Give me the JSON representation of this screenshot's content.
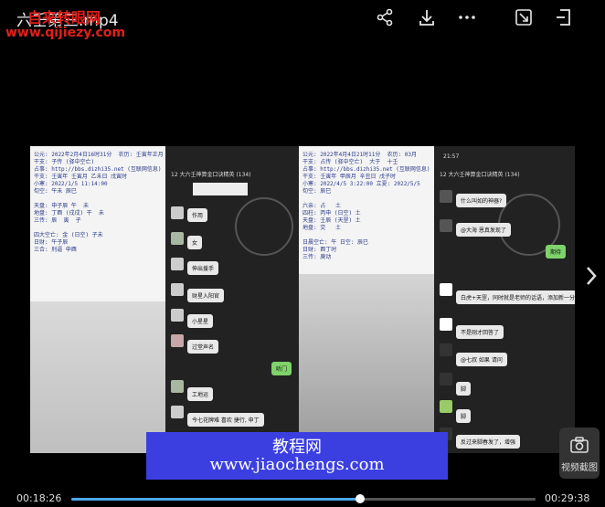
{
  "header": {
    "title": "六壬第三.mp4",
    "watermark_line1": "自来转眼网",
    "watermark_line2": "www.qijiezy.com",
    "icons": [
      "share-icon",
      "download-icon",
      "more-icon",
      "screen-mirror-icon",
      "exit-fullscreen-icon"
    ]
  },
  "video": {
    "doc_left": {
      "lines": "公元: 2022年2月4日16时31分  农历: 壬寅年正月\n干支: 子传 (驿中空亡)\n占事: http://bbs.dizhi35.net (互联网信息)\n干支: 壬寅年 壬寅月 乙未日 戊寅时\n小寒: 2022/1/5 11:14:00\n旬空: 午未 辰巳\n\n天盘: 申子辰 午  未\n地盘: 丁酉 (戌戌) 干  未\n三传: 辰  寅  子\n\n四大空亡: 金 (日空) 子未\n日财: 午子辰\n三合: 刑逼 申酉"
    },
    "chat1": {
      "header": "12  大六壬神算金口诀精英 (134)",
      "bubbles": [
        "作用",
        "女",
        "伸出援手",
        "财星入阳官",
        "小星星",
        "过堂声名",
        "工地运",
        "今七花牌难 喜欢 捷行, 申丁"
      ],
      "green_bubble": "听门"
    },
    "doc_right": {
      "lines": "公元: 2022年4月4日21时11分  农历: 03月\n干支: 占传 (驿中空亡)  大于  十壬\n占事: http://bbs.dizhi35.net (互联网信息)\n干支: 壬寅年 甲辰月 辛丑日 戊子时\n小寒: 2022/4/5 3:22:00 立夏: 2022/5/5\n旬空: 辰巳\n\n六亲: 占   土\n四柱: 丙申 (日空) 土\n天盘: 壬辰 (天罡) 土\n地盘: 交   土\n\n日晨空亡: 午 日空: 辰巳\n日财: 酉丁时\n三传: 庚动"
    },
    "chat2": {
      "time": "21:57",
      "header": "12  大六壬神算金口诀精英 (134)",
      "bubbles": [
        "什么叫如的神器?",
        "@大海 恩真发现了",
        "白虎+天罡，同时就是老师的话语，添加新一分",
        "不是刚才回答了",
        "@七叔 如果 请问",
        "脚",
        "脚",
        "反过来脚春发了，增强"
      ],
      "green_bubble": "期待"
    },
    "banner_line1": "教程网",
    "banner_line2": "www.jiaochengs.com"
  },
  "controls": {
    "current_time": "00:18:26",
    "total_time": "00:29:38",
    "progress": 0.622,
    "screenshot_label": "视频截图"
  }
}
